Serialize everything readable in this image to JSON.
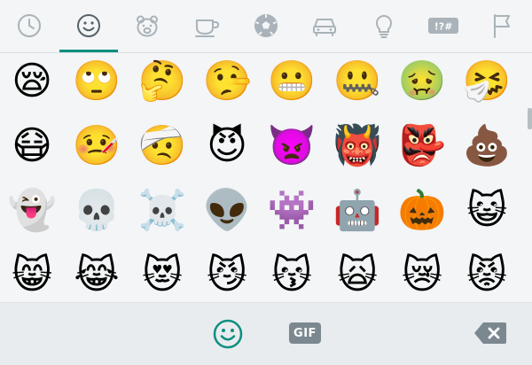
{
  "tabs": [
    {
      "name": "recent",
      "icon": "clock-icon",
      "active": false
    },
    {
      "name": "smileys",
      "icon": "smiley-icon",
      "active": true
    },
    {
      "name": "animals",
      "icon": "bear-icon",
      "active": false
    },
    {
      "name": "food",
      "icon": "cup-icon",
      "active": false
    },
    {
      "name": "activity",
      "icon": "soccer-ball-icon",
      "active": false
    },
    {
      "name": "travel",
      "icon": "car-icon",
      "active": false
    },
    {
      "name": "objects",
      "icon": "lightbulb-icon",
      "active": false
    },
    {
      "name": "symbols",
      "icon": "symbols-icon",
      "label": "!?#",
      "active": false
    },
    {
      "name": "flags",
      "icon": "flag-icon",
      "active": false
    }
  ],
  "emoji_rows": [
    [
      "😪",
      "🙄",
      "🤔",
      "🤥",
      "😬",
      "🤐",
      "🤢",
      "🤧"
    ],
    [
      "😷",
      "🤒",
      "🤕",
      "😈",
      "👿",
      "👹",
      "👺",
      "💩"
    ],
    [
      "👻",
      "💀",
      "☠️",
      "👽",
      "👾",
      "🤖",
      "🎃",
      "😺"
    ],
    [
      "😸",
      "😹",
      "😻",
      "😼",
      "😽",
      "🙀",
      "😿",
      "😾"
    ]
  ],
  "bottom_bar": {
    "emoji_button_icon": "smiley-icon",
    "gif_label": "GIF",
    "backspace_icon": "backspace-icon"
  },
  "colors": {
    "accent": "#0c8f80",
    "icon_inactive": "#a9b3b9",
    "icon_active": "#566269",
    "background": "#f3f5f6"
  }
}
